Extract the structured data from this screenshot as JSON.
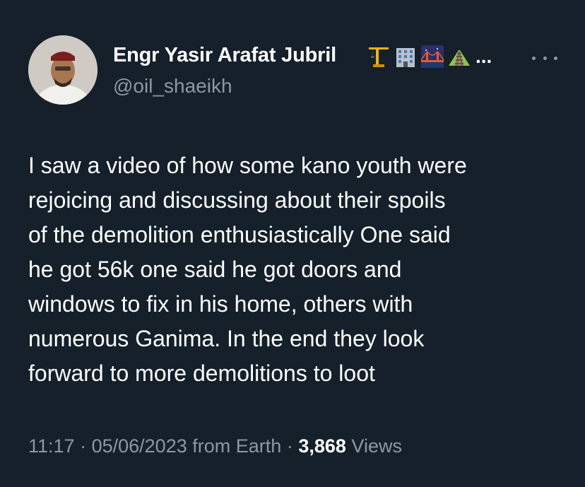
{
  "author": {
    "display_name": "Engr Yasir Arafat Jubril",
    "name_emojis": [
      "crane-emoji",
      "office-building-emoji",
      "bridge-at-night-emoji",
      "railway-track-emoji"
    ],
    "name_truncation": "...",
    "handle": "@oil_shaeikh"
  },
  "tweet": {
    "text_lines": [
      "I saw a video of how some kano youth were",
      "rejoicing and discussing about their spoils",
      "of the demolition enthusiastically One said",
      "he got 56k one said he got doors and",
      "windows to fix in his home, others with",
      "numerous Ganima. In the end they look",
      "forward to more demolitions to loot"
    ]
  },
  "meta": {
    "time": "11:17",
    "separator": "·",
    "date": "05/06/2023",
    "source": "from Earth",
    "views_count": "3,868",
    "views_label": "Views"
  },
  "colors": {
    "background": "#15202b",
    "primary_text": "#ffffff",
    "secondary_text": "#8b98a5"
  }
}
